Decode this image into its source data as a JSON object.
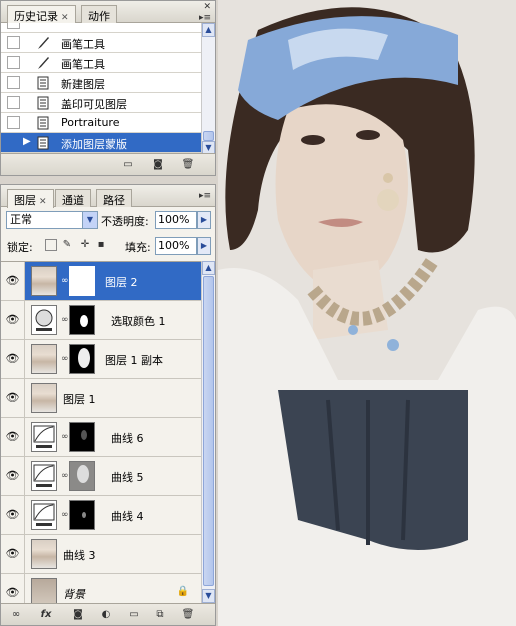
{
  "history": {
    "tabs": [
      {
        "label": "历史记录",
        "active": true
      },
      {
        "label": "动作",
        "active": false
      }
    ],
    "items": [
      {
        "label": "画笔工具",
        "icon": "brush-icon",
        "selected": false
      },
      {
        "label": "画笔工具",
        "icon": "brush-icon",
        "selected": false
      },
      {
        "label": "新建图层",
        "icon": "document-icon",
        "selected": false
      },
      {
        "label": "盖印可见图层",
        "icon": "document-icon",
        "selected": false
      },
      {
        "label": "Portraiture",
        "icon": "document-icon",
        "selected": false
      },
      {
        "label": "添加图层蒙版",
        "icon": "document-icon",
        "selected": true
      }
    ]
  },
  "layers": {
    "tabs": [
      {
        "label": "图层",
        "active": true
      },
      {
        "label": "通道",
        "active": false
      },
      {
        "label": "路径",
        "active": false
      }
    ],
    "blend_mode": "正常",
    "opacity_label": "不透明度:",
    "opacity_value": "100%",
    "lock_label": "锁定:",
    "fill_label": "填充:",
    "fill_value": "100%",
    "items": [
      {
        "name": "图层 2",
        "thumb": "face",
        "mask": "white",
        "selected": true
      },
      {
        "name": "选取颜色 1",
        "thumb": "adjust",
        "mask": "black-spots",
        "selected": false
      },
      {
        "name": "图层 1 副本",
        "thumb": "face",
        "mask": "black-figure",
        "selected": false
      },
      {
        "name": "图层 1",
        "thumb": "face",
        "mask": "",
        "selected": false
      },
      {
        "name": "曲线 6",
        "thumb": "curves",
        "mask": "black-dim",
        "selected": false
      },
      {
        "name": "曲线 5",
        "thumb": "curves",
        "mask": "gray-figure",
        "selected": false
      },
      {
        "name": "曲线 4",
        "thumb": "curves",
        "mask": "black-small",
        "selected": false
      },
      {
        "name": "曲线 3",
        "thumb": "face",
        "mask": "",
        "selected": false
      },
      {
        "name": "背景",
        "thumb": "bg",
        "mask": "",
        "selected": false,
        "locked": true
      }
    ]
  },
  "colors": {
    "selection": "#316ac5",
    "panel_bg": "#f4f2ec"
  }
}
